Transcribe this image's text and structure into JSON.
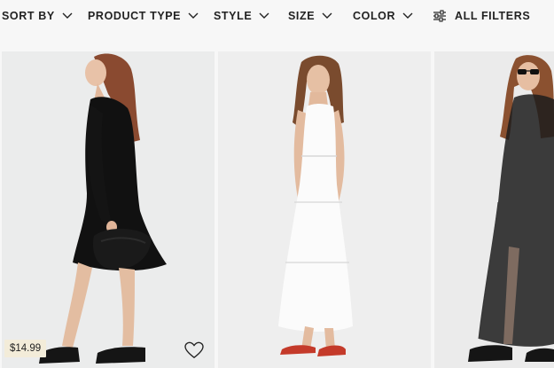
{
  "filters": {
    "sort_by": "SORT BY",
    "product_type": "PRODUCT TYPE",
    "style": "STYLE",
    "size": "SIZE",
    "color": "COLOR",
    "all_filters": "ALL FILTERS"
  },
  "products": [
    {
      "price": "$14.99",
      "image": "black-dress-model",
      "icon": "heart-icon"
    },
    {
      "image": "white-maxi-dress-model",
      "icon": "heart-icon"
    },
    {
      "image": "sheer-black-dress-model"
    }
  ],
  "colors": {
    "accent_price_tag": "#f3ecd9",
    "text": "#222222",
    "background": "#f7f7f7"
  }
}
